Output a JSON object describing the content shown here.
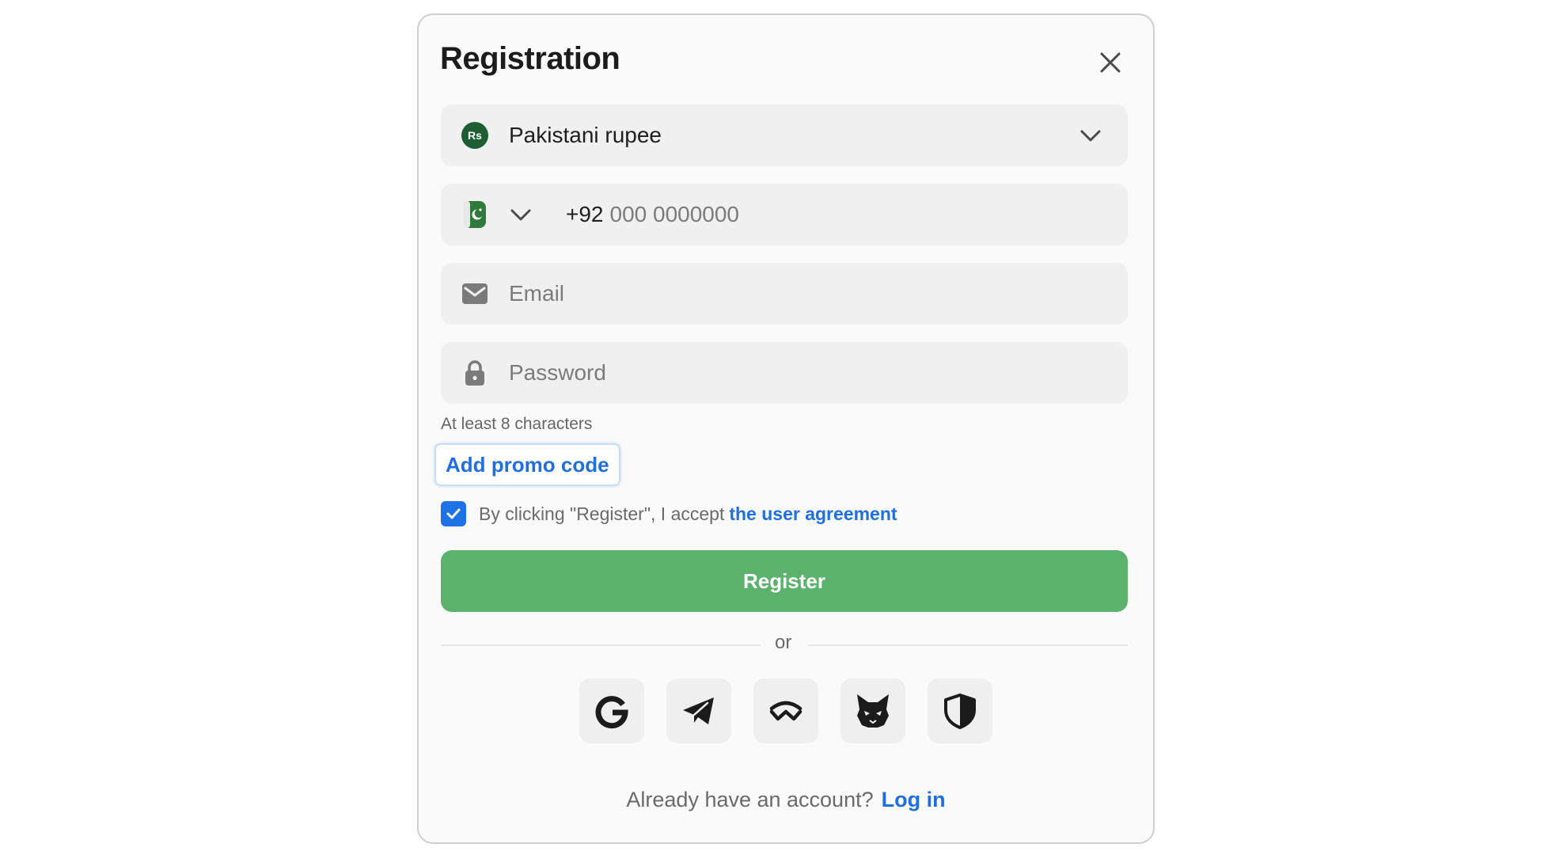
{
  "modal": {
    "title": "Registration",
    "close_icon": "close-icon"
  },
  "currency": {
    "badge": "Rs",
    "value": "Pakistani rupee",
    "icon": "chevron-down-icon"
  },
  "phone": {
    "flag_icon": "pakistan-flag-icon",
    "code": "+92",
    "placeholder": "000 0000000"
  },
  "email": {
    "icon": "envelope-icon",
    "placeholder": "Email"
  },
  "password": {
    "icon": "lock-icon",
    "placeholder": "Password",
    "hint": "At least 8 characters"
  },
  "promo": {
    "label": "Add promo code"
  },
  "agreement": {
    "checked": true,
    "text": "By clicking \"Register\", I accept",
    "link": "the user agreement"
  },
  "register": {
    "label": "Register",
    "color": "#5ab26d"
  },
  "divider": {
    "label": "or"
  },
  "socials": [
    {
      "name": "google-icon"
    },
    {
      "name": "telegram-icon"
    },
    {
      "name": "walletconnect-icon"
    },
    {
      "name": "metamask-icon"
    },
    {
      "name": "shield-icon"
    }
  ],
  "footer": {
    "text": "Already have an account?",
    "link": "Log in"
  },
  "colors": {
    "accent": "#1f6fe0",
    "field_bg": "#f0f0f0"
  }
}
